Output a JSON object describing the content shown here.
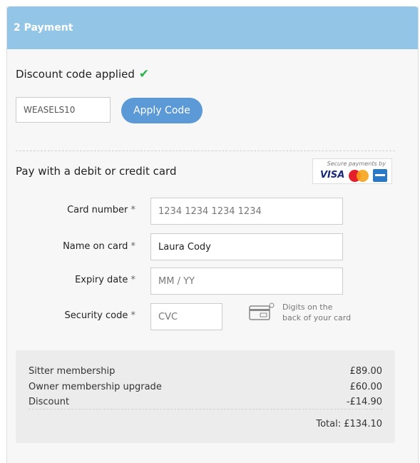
{
  "header": {
    "title": "2 Payment"
  },
  "discount": {
    "title": "Discount code applied",
    "code_value": "WEASELS10",
    "apply_label": "Apply Code"
  },
  "card": {
    "title": "Pay with a debit or credit card",
    "secure_caption": "Secure payments by",
    "brands": {
      "visa": "VISA"
    },
    "card_number": {
      "label": "Card number",
      "required": "*",
      "placeholder": "1234 1234 1234 1234",
      "value": ""
    },
    "name_on_card": {
      "label": "Name on card",
      "required": "*",
      "value": "Laura Cody"
    },
    "expiry": {
      "label": "Expiry date",
      "required": "*",
      "placeholder": "MM / YY",
      "value": ""
    },
    "security": {
      "label": "Security code",
      "required": "*",
      "placeholder": "CVC",
      "value": "",
      "hint_line1": "Digits on the",
      "hint_line2": "back of your card"
    }
  },
  "summary": {
    "items": [
      {
        "label": "Sitter membership",
        "amount": "£89.00"
      },
      {
        "label": "Owner membership upgrade",
        "amount": "£60.00"
      },
      {
        "label": "Discount",
        "amount": "-£14.90"
      }
    ],
    "total": "Total: £134.10"
  },
  "colors": {
    "header": "#93c6e6",
    "button": "#5b9ad6",
    "check": "#2bb24c"
  }
}
